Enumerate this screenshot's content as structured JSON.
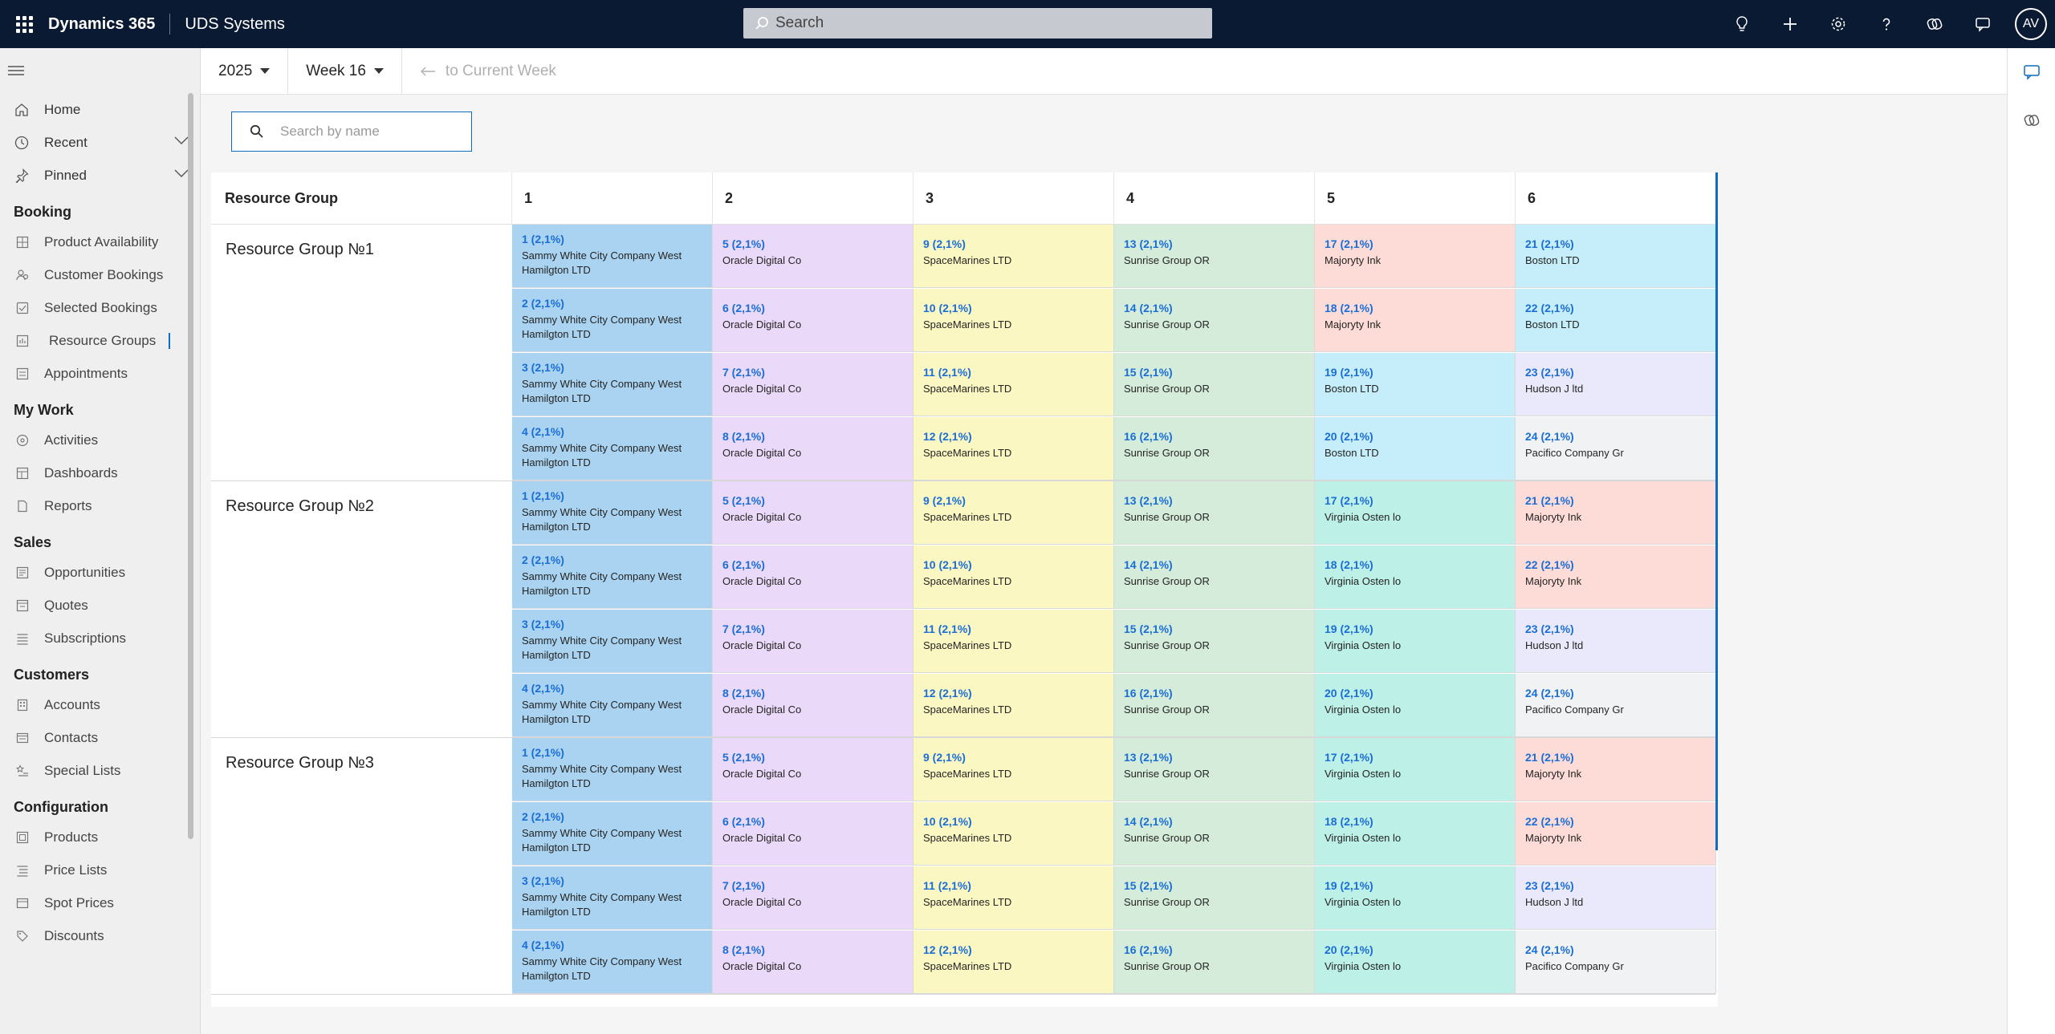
{
  "topbar": {
    "brand": "Dynamics 365",
    "app_name": "UDS Systems",
    "search_placeholder": "Search",
    "avatar_initials": "AV"
  },
  "sidebar": {
    "top_items": [
      {
        "label": "Home",
        "icon": "home-icon"
      },
      {
        "label": "Recent",
        "icon": "clock-icon"
      },
      {
        "label": "Pinned",
        "icon": "pin-icon"
      }
    ],
    "sections": [
      {
        "title": "Booking",
        "items": [
          "Product Availability",
          "Customer Bookings",
          "Selected Bookings",
          "Resource Groups",
          "Appointments"
        ]
      },
      {
        "title": "My Work",
        "items": [
          "Activities",
          "Dashboards",
          "Reports"
        ]
      },
      {
        "title": "Sales",
        "items": [
          "Opportunities",
          "Quotes",
          "Subscriptions"
        ]
      },
      {
        "title": "Customers",
        "items": [
          "Accounts",
          "Contacts",
          "Special Lists"
        ]
      },
      {
        "title": "Configuration",
        "items": [
          "Products",
          "Price Lists",
          "Spot Prices",
          "Discounts"
        ]
      }
    ],
    "active_item": "Resource Groups"
  },
  "commandbar": {
    "year": "2025",
    "week": "Week 16",
    "to_current": "to Current Week"
  },
  "name_search": {
    "placeholder": "Search by name"
  },
  "board": {
    "header_first": "Resource Group",
    "columns": [
      "1",
      "2",
      "3",
      "4",
      "5",
      "6"
    ],
    "colors": {
      "blue": "#a9d3f1",
      "purple": "#ead9f8",
      "yellow": "#fbf7c2",
      "green": "#d4ecd9",
      "pink": "#fddbd7",
      "cyan": "#c6eefa",
      "teal": "#bdf0e6",
      "lavender": "#e9e9fb",
      "gray": "#f1f2f4"
    },
    "groups": [
      {
        "title": "Resource Group №1",
        "rows": [
          [
            {
              "count": "1 (2,1%)",
              "name": "Sammy White City Company West Hamilgton LTD",
              "color": "blue"
            },
            {
              "count": "5 (2,1%)",
              "name": "Oracle Digital Co",
              "color": "purple"
            },
            {
              "count": "9 (2,1%)",
              "name": "SpaceMarines LTD",
              "color": "yellow"
            },
            {
              "count": "13 (2,1%)",
              "name": "Sunrise Group OR",
              "color": "green"
            },
            {
              "count": "17 (2,1%)",
              "name": "Majoryty Ink",
              "color": "pink"
            },
            {
              "count": "21 (2,1%)",
              "name": "Boston LTD",
              "color": "cyan"
            }
          ],
          [
            {
              "count": "2 (2,1%)",
              "name": "Sammy White City Company West Hamilgton LTD",
              "color": "blue"
            },
            {
              "count": "6 (2,1%)",
              "name": "Oracle Digital Co",
              "color": "purple"
            },
            {
              "count": "10 (2,1%)",
              "name": "SpaceMarines LTD",
              "color": "yellow"
            },
            {
              "count": "14 (2,1%)",
              "name": "Sunrise Group OR",
              "color": "green"
            },
            {
              "count": "18 (2,1%)",
              "name": "Majoryty Ink",
              "color": "pink"
            },
            {
              "count": "22 (2,1%)",
              "name": "Boston LTD",
              "color": "cyan"
            }
          ],
          [
            {
              "count": "3 (2,1%)",
              "name": "Sammy White City Company West Hamilgton LTD",
              "color": "blue"
            },
            {
              "count": "7 (2,1%)",
              "name": "Oracle Digital Co",
              "color": "purple"
            },
            {
              "count": "11 (2,1%)",
              "name": "SpaceMarines LTD",
              "color": "yellow"
            },
            {
              "count": "15 (2,1%)",
              "name": "Sunrise Group OR",
              "color": "green"
            },
            {
              "count": "19 (2,1%)",
              "name": "Boston LTD",
              "color": "cyan"
            },
            {
              "count": "23 (2,1%)",
              "name": "Hudson J ltd",
              "color": "lavender"
            }
          ],
          [
            {
              "count": "4 (2,1%)",
              "name": "Sammy White City Company West Hamilgton LTD",
              "color": "blue"
            },
            {
              "count": "8 (2,1%)",
              "name": "Oracle Digital Co",
              "color": "purple"
            },
            {
              "count": "12 (2,1%)",
              "name": "SpaceMarines LTD",
              "color": "yellow"
            },
            {
              "count": "16 (2,1%)",
              "name": "Sunrise Group OR",
              "color": "green"
            },
            {
              "count": "20 (2,1%)",
              "name": "Boston LTD",
              "color": "cyan"
            },
            {
              "count": "24 (2,1%)",
              "name": "Pacifico Company Gr",
              "color": "gray"
            }
          ]
        ]
      },
      {
        "title": "Resource Group №2",
        "rows": [
          [
            {
              "count": "1 (2,1%)",
              "name": "Sammy White City Company West Hamilgton LTD",
              "color": "blue"
            },
            {
              "count": "5 (2,1%)",
              "name": "Oracle Digital Co",
              "color": "purple"
            },
            {
              "count": "9 (2,1%)",
              "name": "SpaceMarines LTD",
              "color": "yellow"
            },
            {
              "count": "13 (2,1%)",
              "name": "Sunrise Group OR",
              "color": "green"
            },
            {
              "count": "17 (2,1%)",
              "name": "Virginia Osten lo",
              "color": "teal"
            },
            {
              "count": "21 (2,1%)",
              "name": "Majoryty Ink",
              "color": "pink"
            }
          ],
          [
            {
              "count": "2 (2,1%)",
              "name": "Sammy White City Company West Hamilgton LTD",
              "color": "blue"
            },
            {
              "count": "6 (2,1%)",
              "name": "Oracle Digital Co",
              "color": "purple"
            },
            {
              "count": "10 (2,1%)",
              "name": "SpaceMarines LTD",
              "color": "yellow"
            },
            {
              "count": "14 (2,1%)",
              "name": "Sunrise Group OR",
              "color": "green"
            },
            {
              "count": "18 (2,1%)",
              "name": "Virginia Osten lo",
              "color": "teal"
            },
            {
              "count": "22 (2,1%)",
              "name": "Majoryty Ink",
              "color": "pink"
            }
          ],
          [
            {
              "count": "3 (2,1%)",
              "name": "Sammy White City Company West Hamilgton LTD",
              "color": "blue"
            },
            {
              "count": "7 (2,1%)",
              "name": "Oracle Digital Co",
              "color": "purple"
            },
            {
              "count": "11 (2,1%)",
              "name": "SpaceMarines LTD",
              "color": "yellow"
            },
            {
              "count": "15 (2,1%)",
              "name": "Sunrise Group OR",
              "color": "green"
            },
            {
              "count": "19 (2,1%)",
              "name": "Virginia Osten lo",
              "color": "teal"
            },
            {
              "count": "23 (2,1%)",
              "name": "Hudson J ltd",
              "color": "lavender"
            }
          ],
          [
            {
              "count": "4 (2,1%)",
              "name": "Sammy White City Company West Hamilgton LTD",
              "color": "blue"
            },
            {
              "count": "8 (2,1%)",
              "name": "Oracle Digital Co",
              "color": "purple"
            },
            {
              "count": "12 (2,1%)",
              "name": "SpaceMarines LTD",
              "color": "yellow"
            },
            {
              "count": "16 (2,1%)",
              "name": "Sunrise Group OR",
              "color": "green"
            },
            {
              "count": "20 (2,1%)",
              "name": "Virginia Osten lo",
              "color": "teal"
            },
            {
              "count": "24 (2,1%)",
              "name": "Pacifico Company Gr",
              "color": "gray"
            }
          ]
        ]
      },
      {
        "title": "Resource Group №3",
        "rows": [
          [
            {
              "count": "1 (2,1%)",
              "name": "Sammy White City Company West Hamilgton LTD",
              "color": "blue"
            },
            {
              "count": "5 (2,1%)",
              "name": "Oracle Digital Co",
              "color": "purple"
            },
            {
              "count": "9 (2,1%)",
              "name": "SpaceMarines LTD",
              "color": "yellow"
            },
            {
              "count": "13 (2,1%)",
              "name": "Sunrise Group OR",
              "color": "green"
            },
            {
              "count": "17 (2,1%)",
              "name": "Virginia Osten lo",
              "color": "teal"
            },
            {
              "count": "21 (2,1%)",
              "name": "Majoryty Ink",
              "color": "pink"
            }
          ],
          [
            {
              "count": "2 (2,1%)",
              "name": "Sammy White City Company West Hamilgton LTD",
              "color": "blue"
            },
            {
              "count": "6 (2,1%)",
              "name": "Oracle Digital Co",
              "color": "purple"
            },
            {
              "count": "10 (2,1%)",
              "name": "SpaceMarines LTD",
              "color": "yellow"
            },
            {
              "count": "14 (2,1%)",
              "name": "Sunrise Group OR",
              "color": "green"
            },
            {
              "count": "18 (2,1%)",
              "name": "Virginia Osten lo",
              "color": "teal"
            },
            {
              "count": "22 (2,1%)",
              "name": "Majoryty Ink",
              "color": "pink"
            }
          ],
          [
            {
              "count": "3 (2,1%)",
              "name": "Sammy White City Company West Hamilgton LTD",
              "color": "blue"
            },
            {
              "count": "7 (2,1%)",
              "name": "Oracle Digital Co",
              "color": "purple"
            },
            {
              "count": "11 (2,1%)",
              "name": "SpaceMarines LTD",
              "color": "yellow"
            },
            {
              "count": "15 (2,1%)",
              "name": "Sunrise Group OR",
              "color": "green"
            },
            {
              "count": "19 (2,1%)",
              "name": "Virginia Osten lo",
              "color": "teal"
            },
            {
              "count": "23 (2,1%)",
              "name": "Hudson J ltd",
              "color": "lavender"
            }
          ],
          [
            {
              "count": "4 (2,1%)",
              "name": "Sammy White City Company West Hamilgton LTD",
              "color": "blue"
            },
            {
              "count": "8 (2,1%)",
              "name": "Oracle Digital Co",
              "color": "purple"
            },
            {
              "count": "12 (2,1%)",
              "name": "SpaceMarines LTD",
              "color": "yellow"
            },
            {
              "count": "16 (2,1%)",
              "name": "Sunrise Group OR",
              "color": "green"
            },
            {
              "count": "20 (2,1%)",
              "name": "Virginia Osten lo",
              "color": "teal"
            },
            {
              "count": "24 (2,1%)",
              "name": "Pacifico Company Gr",
              "color": "gray"
            }
          ]
        ]
      }
    ]
  }
}
